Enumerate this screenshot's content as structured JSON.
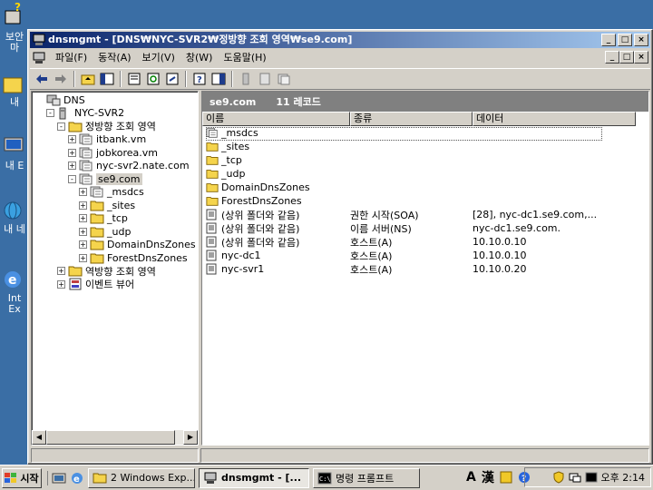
{
  "desktop": {
    "icons": [
      {
        "label": "보안",
        "sub": "마"
      },
      {
        "label": "내"
      },
      {
        "label": "내 E"
      },
      {
        "label": "내 네"
      },
      {
        "label": "Int",
        "sub": "Ex"
      }
    ]
  },
  "window": {
    "title": "dnsmgmt - [DNS₩NYC-SVR2₩정방향 조회 영역₩se9.com]",
    "buttons": {
      "min": "_",
      "max": "□",
      "close": "×"
    }
  },
  "menubar": {
    "items": [
      "파일(F)",
      "동작(A)",
      "보기(V)",
      "창(W)",
      "도움말(H)"
    ]
  },
  "tree": {
    "nodes": [
      {
        "label": "DNS",
        "indent": 0,
        "pm": "",
        "icon": "dns"
      },
      {
        "label": "NYC-SVR2",
        "indent": 1,
        "pm": "-",
        "icon": "server"
      },
      {
        "label": "정방향 조회 영역",
        "indent": 2,
        "pm": "-",
        "icon": "folder"
      },
      {
        "label": "itbank.vm",
        "indent": 3,
        "pm": "+",
        "icon": "zone"
      },
      {
        "label": "jobkorea.vm",
        "indent": 3,
        "pm": "+",
        "icon": "zone"
      },
      {
        "label": "nyc-svr2.nate.com",
        "indent": 3,
        "pm": "+",
        "icon": "zone"
      },
      {
        "label": "se9.com",
        "indent": 3,
        "pm": "-",
        "icon": "zone",
        "selected": true
      },
      {
        "label": "_msdcs",
        "indent": 4,
        "pm": "+",
        "icon": "zone"
      },
      {
        "label": "_sites",
        "indent": 4,
        "pm": "+",
        "icon": "folder"
      },
      {
        "label": "_tcp",
        "indent": 4,
        "pm": "+",
        "icon": "folder"
      },
      {
        "label": "_udp",
        "indent": 4,
        "pm": "+",
        "icon": "folder"
      },
      {
        "label": "DomainDnsZones",
        "indent": 4,
        "pm": "+",
        "icon": "folder"
      },
      {
        "label": "ForestDnsZones",
        "indent": 4,
        "pm": "+",
        "icon": "folder"
      },
      {
        "label": "역방향 조회 영역",
        "indent": 2,
        "pm": "+",
        "icon": "folder"
      },
      {
        "label": "이벤트 뷰어",
        "indent": 2,
        "pm": "+",
        "icon": "events"
      }
    ]
  },
  "list": {
    "zone": "se9.com",
    "count": "11 레코드",
    "columns": [
      "이름",
      "종류",
      "데이터"
    ],
    "rows": [
      {
        "name": "_msdcs",
        "type": "",
        "data": "",
        "icon": "zone"
      },
      {
        "name": "_sites",
        "type": "",
        "data": "",
        "icon": "folder"
      },
      {
        "name": "_tcp",
        "type": "",
        "data": "",
        "icon": "folder"
      },
      {
        "name": "_udp",
        "type": "",
        "data": "",
        "icon": "folder"
      },
      {
        "name": "DomainDnsZones",
        "type": "",
        "data": "",
        "icon": "folder"
      },
      {
        "name": "ForestDnsZones",
        "type": "",
        "data": "",
        "icon": "folder"
      },
      {
        "name": "(상위 폴더와 같음)",
        "type": "권한 시작(SOA)",
        "data": "[28], nyc-dc1.se9.com,...",
        "icon": "record"
      },
      {
        "name": "(상위 폴더와 같음)",
        "type": "이름 서버(NS)",
        "data": "nyc-dc1.se9.com.",
        "icon": "record"
      },
      {
        "name": "(상위 폴더와 같음)",
        "type": "호스트(A)",
        "data": "10.10.0.10",
        "icon": "record"
      },
      {
        "name": "nyc-dc1",
        "type": "호스트(A)",
        "data": "10.10.0.10",
        "icon": "record"
      },
      {
        "name": "nyc-svr1",
        "type": "호스트(A)",
        "data": "10.10.0.20",
        "icon": "record"
      }
    ]
  },
  "taskbar": {
    "start": "시작",
    "tasks": [
      {
        "label": "2 Windows Exp...",
        "icon": "folder"
      },
      {
        "label": "dnsmgmt - [...",
        "icon": "mmc",
        "active": true
      },
      {
        "label": "명령 프롬프트",
        "icon": "cmd"
      }
    ],
    "ime": [
      "A",
      "漢"
    ],
    "clock": "오후 2:14"
  },
  "colors": {
    "desktop": "#3a6ea5",
    "title_start": "#0a246a",
    "title_end": "#a6caf0",
    "face": "#d4d0c8",
    "folder": "#f5d44c"
  }
}
